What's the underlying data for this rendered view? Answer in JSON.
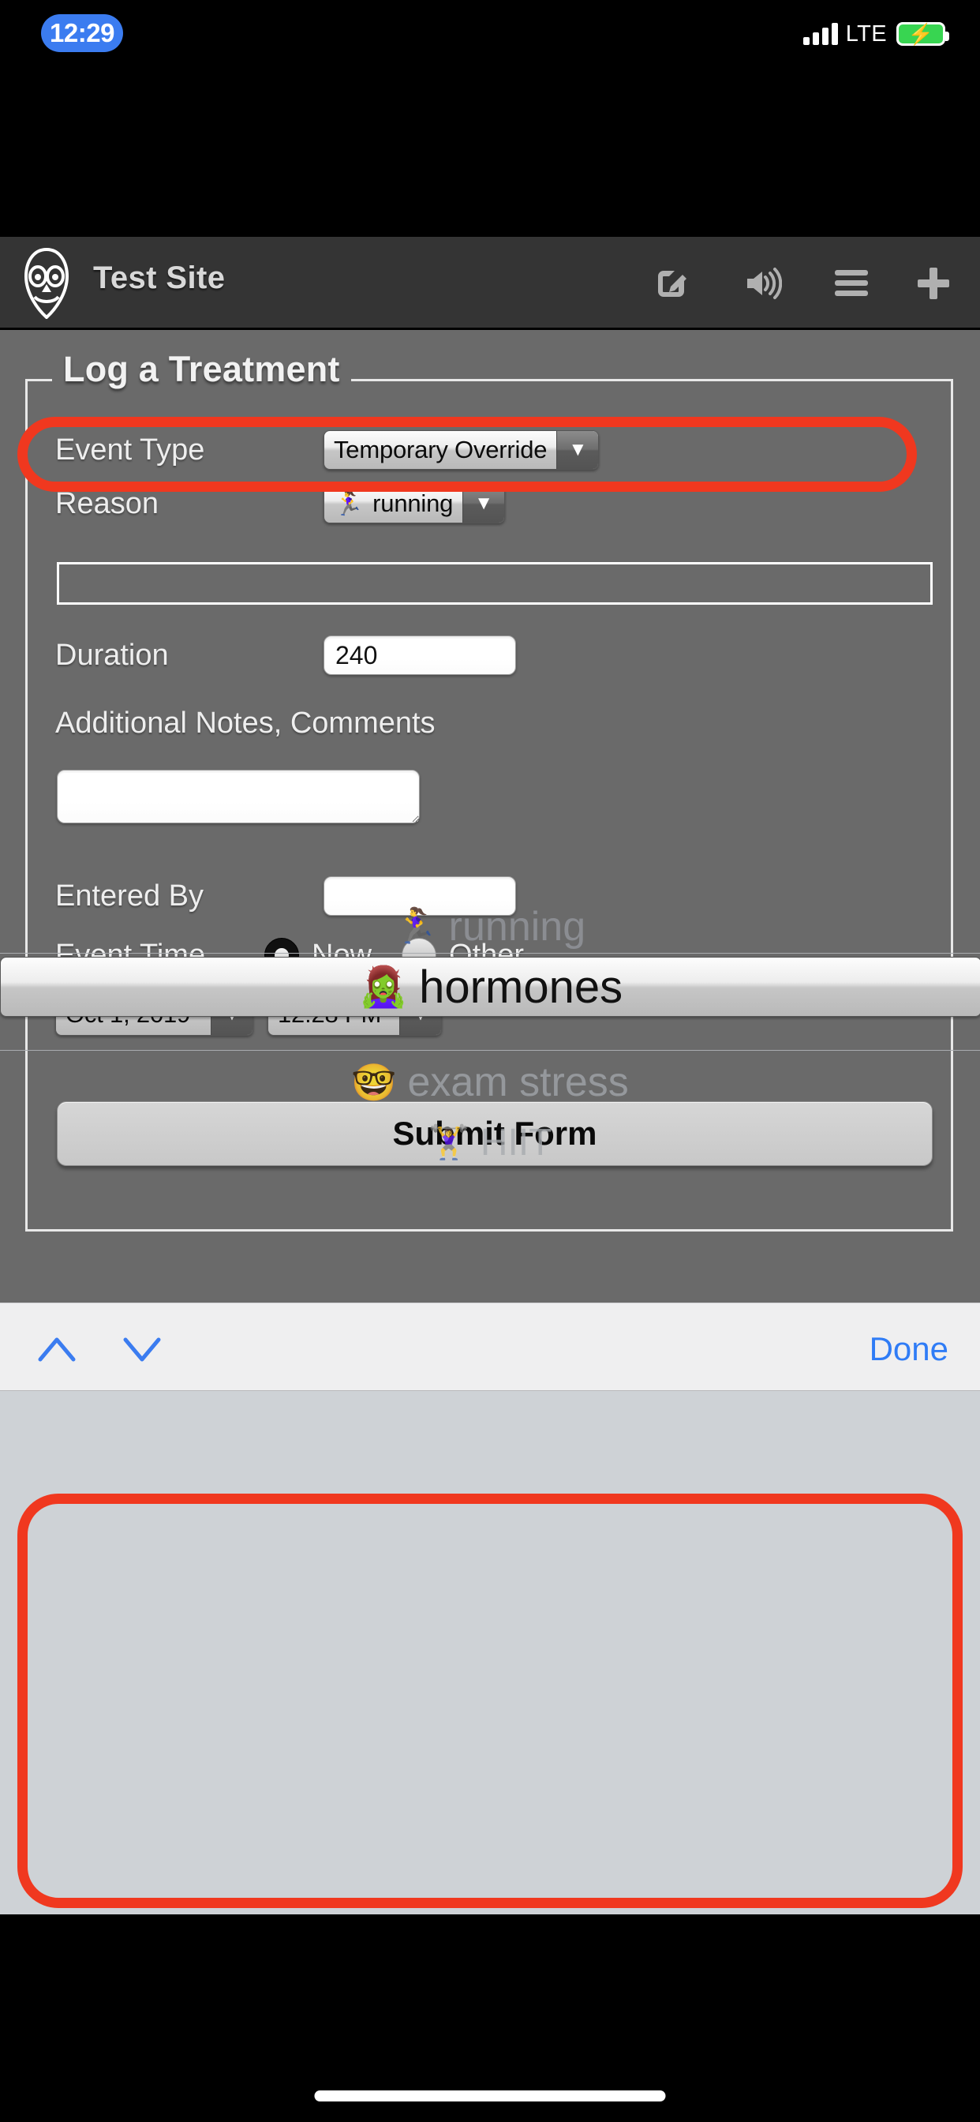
{
  "status_bar": {
    "time": "12:29",
    "carrier": "LTE",
    "signal_icon": "signal-bars-icon",
    "battery_icon": "battery-charging-icon",
    "battery_color": "#38d551",
    "time_pill_color": "#3b7cf0"
  },
  "app_header": {
    "title": "Test Site",
    "logo_icon": "owl-logo-icon",
    "background": "#343434",
    "icons": [
      {
        "name": "compose-icon",
        "label": "Compose"
      },
      {
        "name": "speaker-icon",
        "label": "Sound"
      },
      {
        "name": "hamburger-menu-icon",
        "label": "Menu"
      },
      {
        "name": "plus-icon",
        "label": "Add"
      }
    ]
  },
  "form": {
    "legend": "Log a Treatment",
    "panel_background": "#6a6a6a",
    "event_type": {
      "label": "Event Type",
      "value": "Temporary Override",
      "dropdown_icon": "chevron-down-icon"
    },
    "reason": {
      "label": "Reason",
      "emoji": "🏃‍♀️",
      "value": "running",
      "dropdown_icon": "chevron-down-icon"
    },
    "profile_box": {
      "value": ""
    },
    "duration": {
      "label": "Duration",
      "value": "240",
      "placeholder": ""
    },
    "notes": {
      "label": "Additional Notes, Comments",
      "value": "",
      "placeholder": ""
    },
    "entered_by": {
      "label": "Entered By",
      "value": "",
      "placeholder": ""
    },
    "event_time": {
      "label": "Event Time",
      "options": [
        {
          "label": "Now",
          "selected": true
        },
        {
          "label": "Other",
          "selected": false
        }
      ],
      "date_value": "Oct 1, 2019",
      "time_value": "12:28 PM",
      "dropdown_icon": "chevron-down-icon"
    },
    "submit": {
      "label": "Submit Form"
    }
  },
  "accessory_bar": {
    "prev_icon": "chevron-up-icon",
    "next_icon": "chevron-down-icon",
    "done_label": "Done",
    "accent_color": "#2f7cf6",
    "background": "#efeff0"
  },
  "picker": {
    "background": "#ced2d6",
    "selected_index": 1,
    "items": [
      {
        "emoji": "🏃‍♀️",
        "label": "running"
      },
      {
        "emoji": "🧟‍♀️",
        "label": "hormones"
      },
      {
        "emoji": "🤓",
        "label": "exam stress"
      },
      {
        "emoji": "🏋️‍♀️",
        "label": "HIIT"
      }
    ]
  },
  "annotations": {
    "color": "#f0381f",
    "regions": [
      {
        "name": "event-type-highlight",
        "target": "Event Type row"
      },
      {
        "name": "picker-highlight",
        "target": "Reason picker wheel"
      }
    ]
  }
}
